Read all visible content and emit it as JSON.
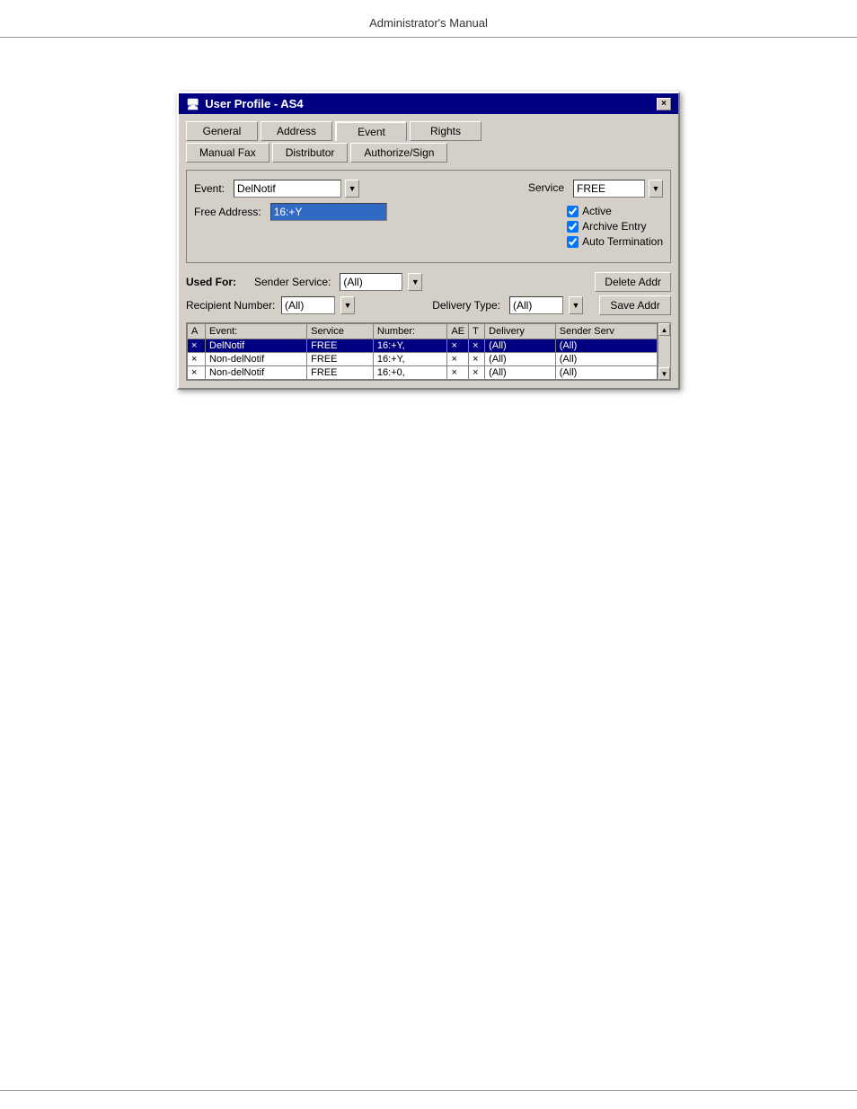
{
  "header": {
    "title": "Administrator's Manual"
  },
  "dialog": {
    "title": "User Profile - AS4",
    "close_label": "×",
    "tabs_row1": [
      {
        "label": "General",
        "active": false,
        "disabled": false
      },
      {
        "label": "Address",
        "active": false,
        "disabled": false
      },
      {
        "label": "Event",
        "active": true,
        "disabled": false
      },
      {
        "label": "Rights",
        "active": false,
        "disabled": false
      }
    ],
    "tabs_row2": [
      {
        "label": "Manual Fax",
        "active": false,
        "disabled": false
      },
      {
        "label": "Distributor",
        "active": false,
        "disabled": false
      },
      {
        "label": "Authorize/Sign",
        "active": false,
        "disabled": false
      }
    ],
    "form": {
      "event_label": "Event:",
      "event_value": "DelNotif",
      "service_label": "Service",
      "service_value": "FREE",
      "free_address_label": "Free Address:",
      "free_address_value": "16:+Y",
      "checkboxes": [
        {
          "label": "Active",
          "checked": true
        },
        {
          "label": "Archive Entry",
          "checked": true
        },
        {
          "label": "Auto Termination",
          "checked": true
        }
      ]
    },
    "used_for": {
      "label": "Used For:",
      "sender_service_label": "Sender Service:",
      "sender_service_value": "(All)",
      "delete_btn": "Delete Addr",
      "recipient_label": "Recipient Number:",
      "recipient_value": "(All)",
      "delivery_type_label": "Delivery Type:",
      "delivery_type_value": "(All)",
      "save_btn": "Save Addr"
    },
    "table": {
      "columns": [
        "A",
        "Event:",
        "Service",
        "Number:",
        "AE",
        "T",
        "Delivery",
        "Sender Serv"
      ],
      "rows": [
        {
          "a": "×",
          "event": "DelNotif",
          "service": "FREE",
          "number": "16:+Y,",
          "ae": "×",
          "t": "×",
          "delivery": "(All)",
          "sender": "(All)",
          "selected": true
        },
        {
          "a": "×",
          "event": "Non-delNotif",
          "service": "FREE",
          "number": "16:+Y,",
          "ae": "×",
          "t": "×",
          "delivery": "(All)",
          "sender": "(All)",
          "selected": false
        },
        {
          "a": "×",
          "event": "Non-delNotif",
          "service": "FREE",
          "number": "16:+0,",
          "ae": "×",
          "t": "×",
          "delivery": "(All)",
          "sender": "(All)",
          "selected": false
        }
      ]
    }
  }
}
